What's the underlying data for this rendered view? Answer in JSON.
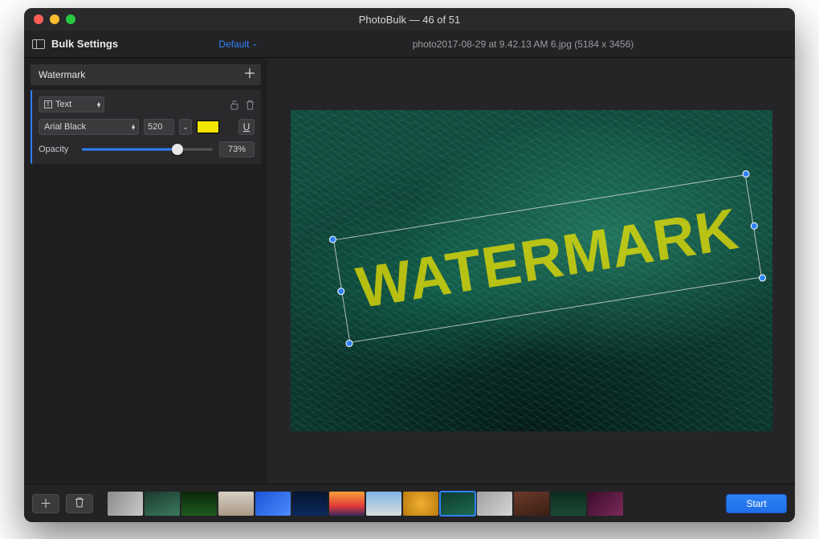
{
  "window_title": "PhotoBulk — 46 of 51",
  "toolbar": {
    "panel_label": "Bulk Settings",
    "preset_label": "Default",
    "filename_info": "photo2017-08-29 at 9.42.13 AM 6.jpg (5184 x 3456)"
  },
  "watermark": {
    "section_title": "Watermark",
    "type_label": "Text",
    "font_name": "Arial Black",
    "font_size": "520",
    "color_hex": "#f3e600",
    "underline_glyph": "U",
    "opacity_label": "Opacity",
    "opacity_value": "73%",
    "opacity_percent": 73,
    "overlay_text": "WATERMARK"
  },
  "footer": {
    "start_label": "Start"
  },
  "thumbnails": [
    {
      "bg": "linear-gradient(120deg,#8b8b8b,#c9c9c9)"
    },
    {
      "bg": "linear-gradient(160deg,#1b3a2e,#3a7a5e)"
    },
    {
      "bg": "linear-gradient(180deg,#0b270a,#1e5a1e)"
    },
    {
      "bg": "linear-gradient(180deg,#d8d0c4,#a89a84)"
    },
    {
      "bg": "linear-gradient(135deg,#1b54d6,#4b8bff)"
    },
    {
      "bg": "linear-gradient(180deg,#05132e,#0b2a5e)"
    },
    {
      "bg": "linear-gradient(180deg,#f6a13a,#e23a3a 60%,#3a2a5e)"
    },
    {
      "bg": "linear-gradient(180deg,#7fb5e6,#dcdcdc)"
    },
    {
      "bg": "radial-gradient(circle,#f0b030,#b97a10)"
    },
    {
      "bg": "linear-gradient(160deg,#0d3a2e,#1e6a4e)",
      "selected": true
    },
    {
      "bg": "linear-gradient(135deg,#a0a0a0,#d6d6d6)"
    },
    {
      "bg": "linear-gradient(160deg,#6b3a2a,#3a1e14)"
    },
    {
      "bg": "linear-gradient(180deg,#0e2a1e,#1a4a34)"
    },
    {
      "bg": "linear-gradient(135deg,#3a0d2a,#7a2a5a)"
    }
  ]
}
